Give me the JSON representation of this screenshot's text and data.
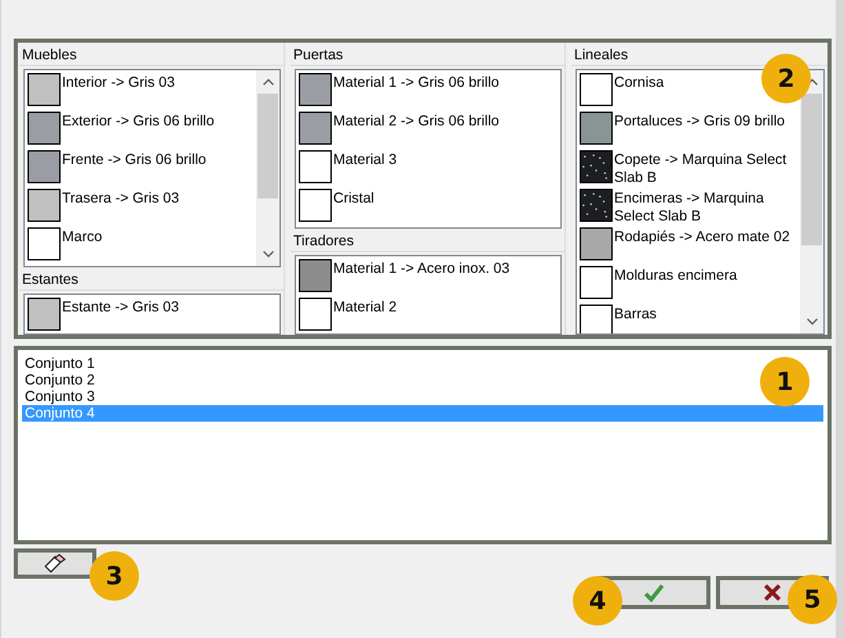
{
  "columns": [
    {
      "groups": [
        {
          "title": "Muebles",
          "scrollbar": true,
          "items": [
            {
              "label": "Interior -> Gris 03",
              "kind": "plain",
              "color": "#c0c0c0"
            },
            {
              "label": "Exterior -> Gris 06 brillo",
              "kind": "plain",
              "color": "#9a9ea4"
            },
            {
              "label": "Frente -> Gris 06 brillo",
              "kind": "plain",
              "color": "#9a9ea4"
            },
            {
              "label": "Trasera -> Gris 03",
              "kind": "plain",
              "color": "#c0c0c0"
            },
            {
              "label": "Marco",
              "kind": "plain",
              "color": "#ffffff"
            }
          ]
        },
        {
          "title": "Estantes",
          "scrollbar": false,
          "items": [
            {
              "label": "Estante -> Gris 03",
              "kind": "plain",
              "color": "#c0c0c0"
            }
          ]
        }
      ]
    },
    {
      "groups": [
        {
          "title": "Puertas",
          "scrollbar": false,
          "items": [
            {
              "label": "Material 1 -> Gris 06 brillo",
              "kind": "plain",
              "color": "#9a9ea4"
            },
            {
              "label": "Material 2 -> Gris 06 brillo",
              "kind": "plain",
              "color": "#9a9ea4"
            },
            {
              "label": "Material 3",
              "kind": "plain",
              "color": "#ffffff"
            },
            {
              "label": "Cristal",
              "kind": "plain",
              "color": "#ffffff"
            }
          ]
        },
        {
          "title": "Tiradores",
          "scrollbar": false,
          "items": [
            {
              "label": "Material 1 -> Acero inox. 03",
              "kind": "plain",
              "color": "#8c8c8c"
            },
            {
              "label": "Material 2",
              "kind": "plain",
              "color": "#ffffff"
            }
          ]
        }
      ]
    },
    {
      "groups": [
        {
          "title": "Lineales",
          "scrollbar": true,
          "items": [
            {
              "label": "Cornisa",
              "kind": "plain",
              "color": "#ffffff"
            },
            {
              "label": "Portaluces -> Gris 09 brillo",
              "kind": "plain",
              "color": "#8a9494"
            },
            {
              "label": "Copete -> Marquina Select Slab B",
              "kind": "granite",
              "color": "#1c1e22"
            },
            {
              "label": "Encimeras -> Marquina Select Slab B",
              "kind": "granite",
              "color": "#1c1e22"
            },
            {
              "label": "Rodapiés -> Acero mate 02",
              "kind": "plain",
              "color": "#a8a8a8"
            },
            {
              "label": "Molduras encimera",
              "kind": "plain",
              "color": "#ffffff"
            },
            {
              "label": "Barras",
              "kind": "plain",
              "color": "#ffffff"
            }
          ]
        }
      ]
    }
  ],
  "sets": [
    {
      "label": "Conjunto 1",
      "selected": false
    },
    {
      "label": "Conjunto 2",
      "selected": false
    },
    {
      "label": "Conjunto 3",
      "selected": false
    },
    {
      "label": "Conjunto 4",
      "selected": true
    }
  ],
  "callouts": [
    "1",
    "2",
    "3",
    "4",
    "5"
  ]
}
